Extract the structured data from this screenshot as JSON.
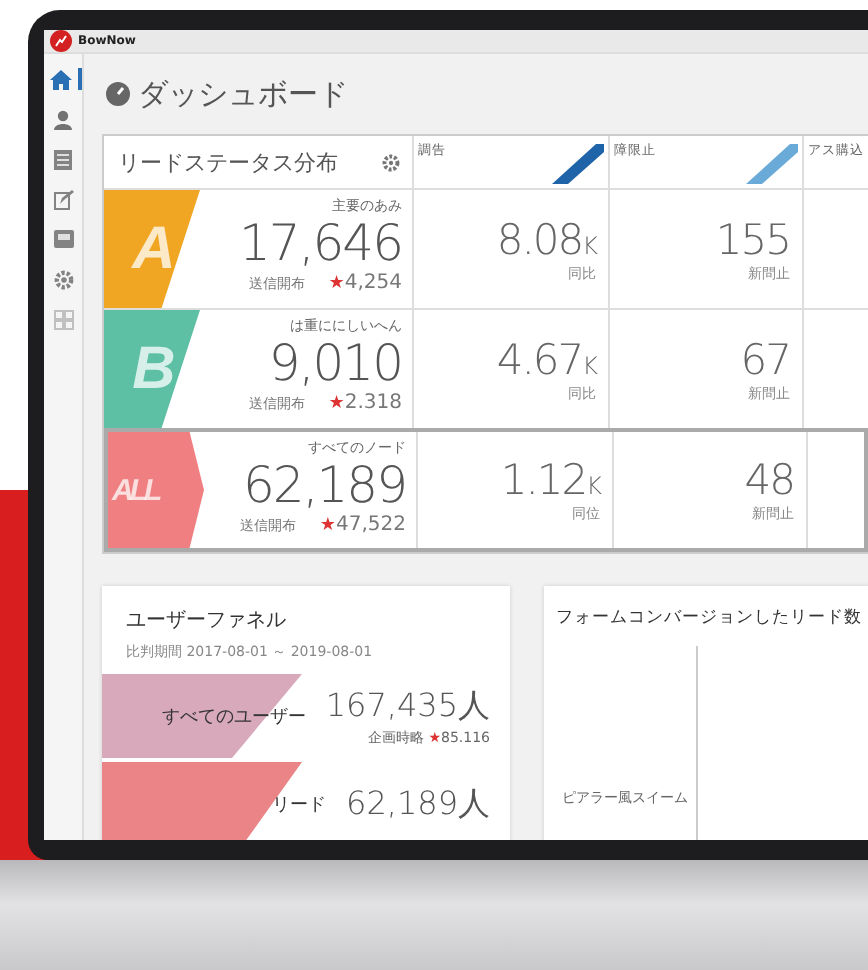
{
  "app": {
    "brand": "BowNow"
  },
  "sidebar": {
    "items": [
      {
        "kind": "home",
        "selected": true
      },
      {
        "kind": "user",
        "selected": false
      },
      {
        "kind": "list",
        "selected": false
      },
      {
        "kind": "edit",
        "selected": false
      },
      {
        "kind": "mail",
        "selected": false
      },
      {
        "kind": "gear",
        "selected": false
      },
      {
        "kind": "grid",
        "selected": false
      }
    ]
  },
  "page": {
    "title": "ダッシュボード"
  },
  "lead_status": {
    "title": "リードステータス分布",
    "columns": [
      {
        "label": "調告",
        "color": "#1f63a8"
      },
      {
        "label": "障限止",
        "color": "#6aaad8"
      },
      {
        "label": "アス購込"
      }
    ],
    "rows": [
      {
        "grade": "A",
        "color": "#f0a623",
        "selected": false,
        "label": "主要のあみ",
        "count": "17,646",
        "sub_label": "送信開布",
        "star": "★",
        "star_value": "4,254",
        "cells": [
          {
            "value": "8.08",
            "unit": "K",
            "caption": "同比"
          },
          {
            "value": "155",
            "caption": "新問止"
          }
        ]
      },
      {
        "grade": "B",
        "color": "#5dbfa3",
        "selected": false,
        "label": "は重ににしいへん",
        "count": "9,010",
        "sub_label": "送信開布",
        "star": "★",
        "star_value": "2.318",
        "cells": [
          {
            "value": "4.67",
            "unit": "K",
            "caption": "同比"
          },
          {
            "value": "67",
            "caption": "新問止"
          }
        ]
      },
      {
        "grade": "ALL",
        "color": "#ef7f80",
        "selected": true,
        "label": "すべてのノード",
        "count": "62,189",
        "sub_label": "送信開布",
        "star": "★",
        "star_value": "47,522",
        "cells": [
          {
            "value": "1.12",
            "unit": "K",
            "caption": "同位"
          },
          {
            "value": "48",
            "caption": "新問止"
          }
        ]
      }
    ]
  },
  "funnel": {
    "title": "ユーザーファネル",
    "period": "比判期間 2017-08-01 ～ 2019-08-01",
    "stages": [
      {
        "label": "すべてのユーザー",
        "count": "167,435人",
        "sub_label": "企画時略",
        "star": "★",
        "star_value": "85.116",
        "color": "#d7a9ba"
      },
      {
        "label": "リード",
        "count": "62,189人",
        "color": "#ea8486"
      }
    ]
  },
  "form_chart": {
    "title": "フォームコンバージョンしたリード数",
    "axis_label": "ピアラー風スイーム"
  }
}
